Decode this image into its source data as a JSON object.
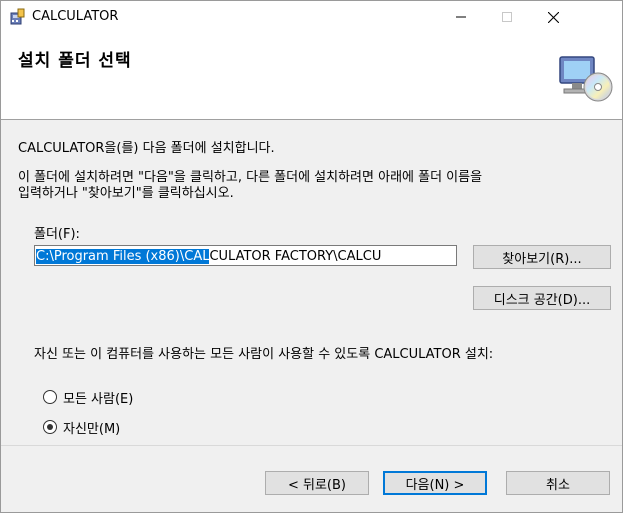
{
  "window": {
    "title": "CALCULATOR"
  },
  "header": {
    "title": "설치 폴더 선택"
  },
  "body": {
    "intro": "CALCULATOR을(를) 다음 폴더에 설치합니다.",
    "instructions_line1": "이 폴더에 설치하려면 \"다음\"을 클릭하고, 다른 폴더에 설치하려면 아래에 폴더 이름을",
    "instructions_line2": "입력하거나 \"찾아보기\"를 클릭하십시오.",
    "folder_label": "폴더(F):",
    "folder_value_selected": "C:\\Program Files (x86)\\CAL",
    "folder_value_rest": "CULATOR FACTORY\\CALCU",
    "browse_label": "찾아보기(R)...",
    "disk_cost_label": "디스크 공간(D)...",
    "install_for_label": "자신 또는 이 컴퓨터를 사용하는 모든 사람이 사용할 수 있도록 CALCULATOR 설치:",
    "options": [
      {
        "label": "모든 사람(E)",
        "checked": false
      },
      {
        "label": "자신만(M)",
        "checked": true
      }
    ]
  },
  "footer": {
    "back_label": "< 뒤로(B)",
    "next_label": "다음(N) >",
    "cancel_label": "취소"
  },
  "colors": {
    "selection": "#0078d7",
    "button_face": "#e1e1e1",
    "dialog_bg": "#f0f0f0"
  },
  "icons": [
    "installer-app-icon",
    "minimize-icon",
    "maximize-icon",
    "close-icon",
    "computer-cd-icon"
  ]
}
